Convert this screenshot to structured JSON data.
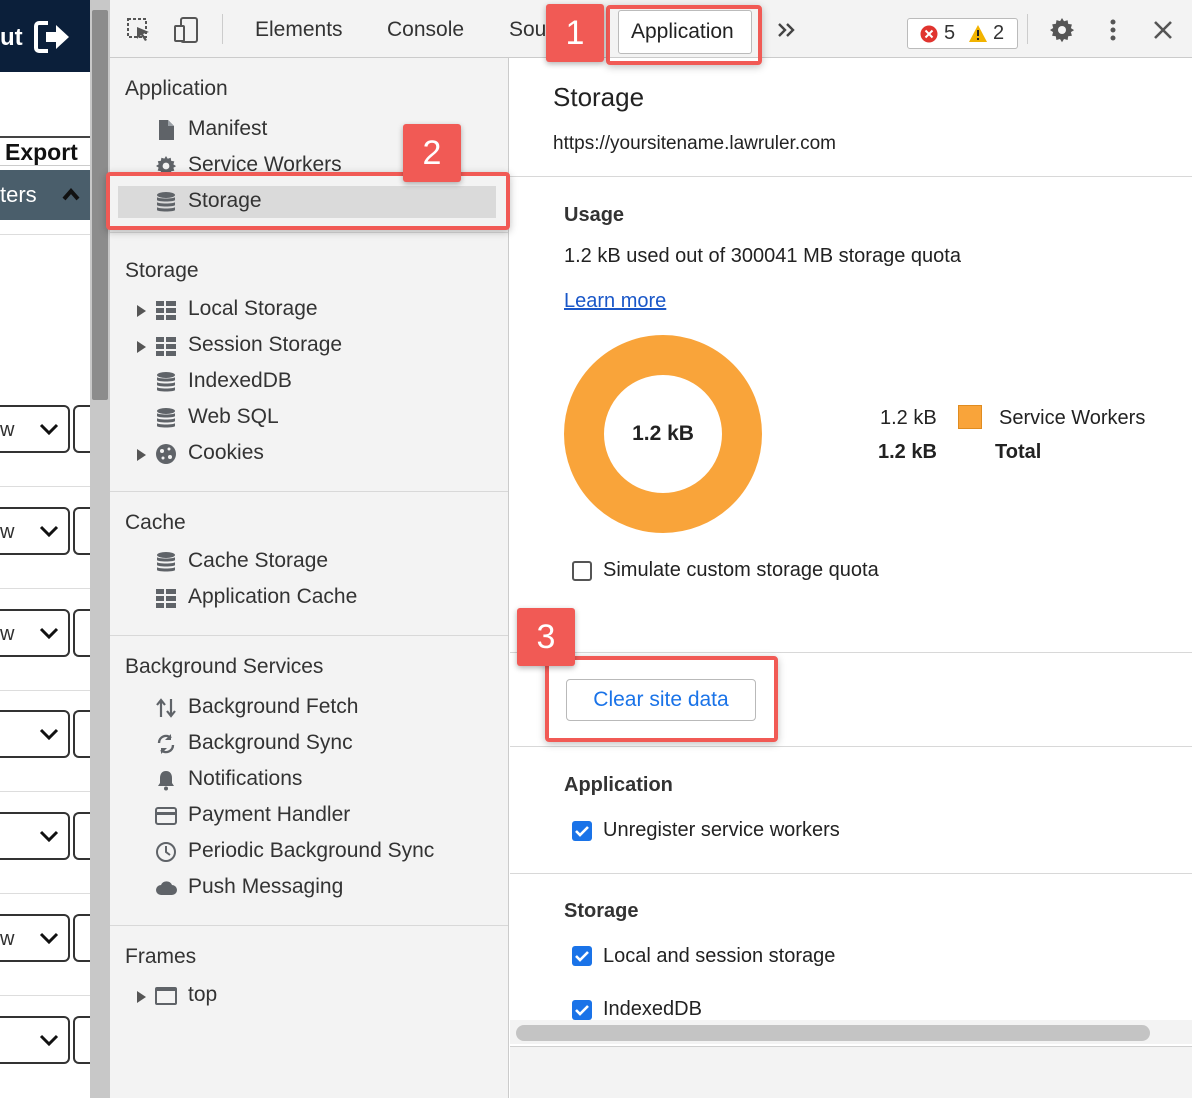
{
  "page_behind": {
    "logout_label": "ut",
    "export_label": "Export",
    "filters_label": "ters",
    "select_value": "w"
  },
  "toolbar": {
    "tabs": [
      "Elements",
      "Console",
      "Sou",
      "Application"
    ],
    "more_icon": "double-chevron-icon",
    "error_count": "5",
    "warning_count": "2"
  },
  "sidebar": {
    "application": {
      "title": "Application",
      "items": [
        "Manifest",
        "Service Workers",
        "Storage"
      ]
    },
    "storage": {
      "title": "Storage",
      "items": [
        "Local Storage",
        "Session Storage",
        "IndexedDB",
        "Web SQL",
        "Cookies"
      ]
    },
    "cache": {
      "title": "Cache",
      "items": [
        "Cache Storage",
        "Application Cache"
      ]
    },
    "background_services": {
      "title": "Background Services",
      "items": [
        "Background Fetch",
        "Background Sync",
        "Notifications",
        "Payment Handler",
        "Periodic Background Sync",
        "Push Messaging"
      ]
    },
    "frames": {
      "title": "Frames",
      "items": [
        "top"
      ]
    }
  },
  "main": {
    "title": "Storage",
    "origin": "https://yoursitename.lawruler.com",
    "usage": {
      "heading": "Usage",
      "summary": "1.2 kB used out of 300041 MB storage quota",
      "learn_more": "Learn more",
      "donut_center": "1.2 kB",
      "legend": [
        {
          "value": "1.2 kB",
          "label": "Service Workers",
          "color": "#f9a43a"
        },
        {
          "value": "1.2 kB",
          "label": "Total"
        }
      ],
      "simulate_label": "Simulate custom storage quota",
      "simulate_checked": false
    },
    "clear_button": "Clear site data",
    "application_section": {
      "heading": "Application",
      "options": [
        {
          "label": "Unregister service workers",
          "checked": true
        }
      ]
    },
    "storage_section": {
      "heading": "Storage",
      "options": [
        {
          "label": "Local and session storage",
          "checked": true
        },
        {
          "label": "IndexedDB",
          "checked": true
        }
      ]
    }
  },
  "callouts": [
    "1",
    "2",
    "3"
  ],
  "colors": {
    "accent": "#1a73e8",
    "callout": "#f15a55",
    "donut": "#f9a43a"
  }
}
